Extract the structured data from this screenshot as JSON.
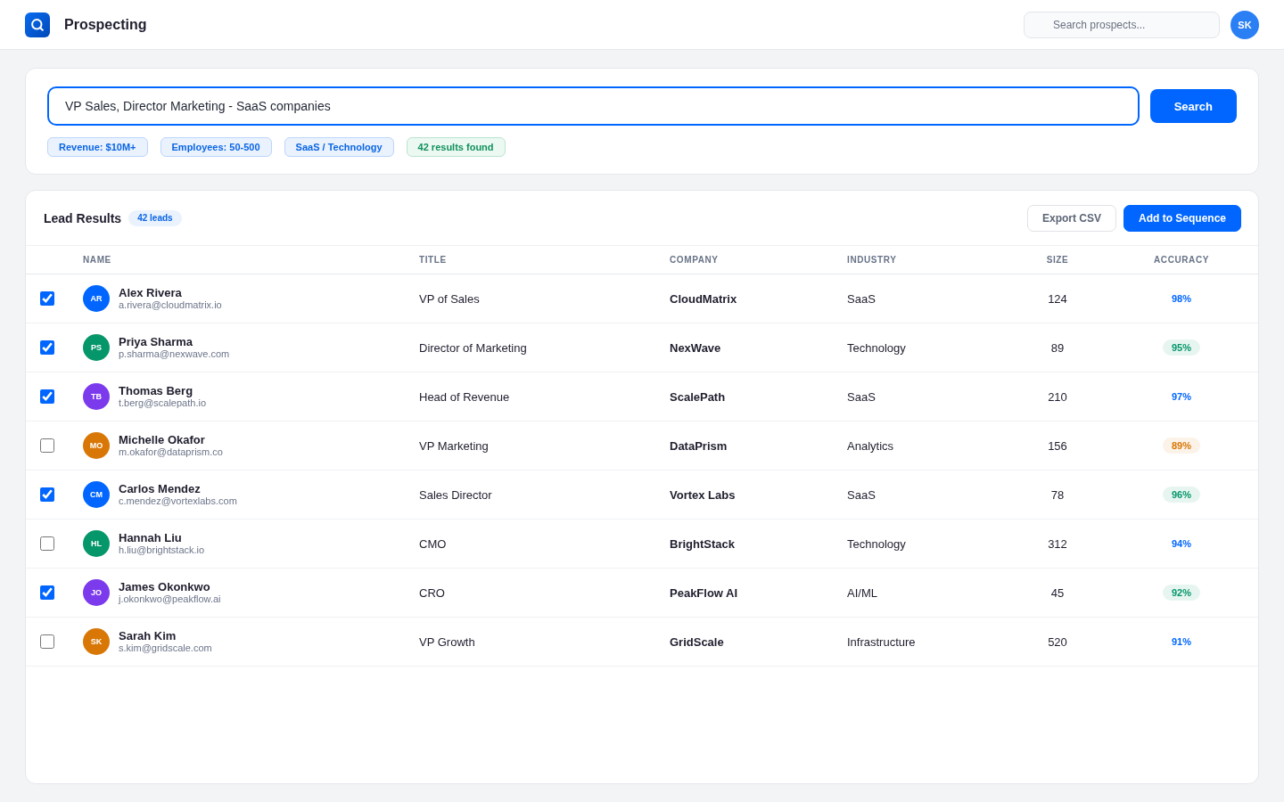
{
  "app": {
    "title": "Prospecting",
    "search": {
      "placeholder": "Search prospects..."
    },
    "user_initials": "SK"
  },
  "query": {
    "value": "VP Sales, Director Marketing - SaaS companies",
    "button": "Search",
    "chips": [
      {
        "label": "Revenue: $10M+",
        "kind": "filter"
      },
      {
        "label": "Employees: 50-500",
        "kind": "filter"
      },
      {
        "label": "SaaS / Technology",
        "kind": "filter"
      },
      {
        "label": "42 results found",
        "kind": "count"
      }
    ]
  },
  "results": {
    "title": "Lead Results",
    "count": "42 leads",
    "buttons": [
      {
        "label": "Export CSV",
        "kind": "secondary"
      },
      {
        "label": "Add to Sequence",
        "kind": "primary"
      }
    ],
    "columns": [
      "NAME",
      "TITLE",
      "COMPANY",
      "INDUSTRY",
      "SIZE",
      "ACCURACY"
    ],
    "rows": [
      {
        "checked": true,
        "initials": "AR",
        "color": "#0066ff",
        "name": "Alex Rivera",
        "email": "a.rivera@cloudmatrix.io",
        "title": "VP of Sales",
        "company": "CloudMatrix",
        "industry": "SaaS",
        "size": "124",
        "accuracy": {
          "value": "98%",
          "kind": "plain",
          "color": "#0066ff"
        }
      },
      {
        "checked": true,
        "initials": "PS",
        "color": "#059669",
        "name": "Priya Sharma",
        "email": "p.sharma@nexwave.com",
        "title": "Director of Marketing",
        "company": "NexWave",
        "industry": "Technology",
        "size": "89",
        "accuracy": {
          "value": "95%",
          "kind": "pill",
          "color": "#059669"
        }
      },
      {
        "checked": true,
        "initials": "TB",
        "color": "#7c3aed",
        "name": "Thomas Berg",
        "email": "t.berg@scalepath.io",
        "title": "Head of Revenue",
        "company": "ScalePath",
        "industry": "SaaS",
        "size": "210",
        "accuracy": {
          "value": "97%",
          "kind": "plain",
          "color": "#0066ff"
        }
      },
      {
        "checked": false,
        "initials": "MO",
        "color": "#d97706",
        "name": "Michelle Okafor",
        "email": "m.okafor@dataprism.co",
        "title": "VP Marketing",
        "company": "DataPrism",
        "industry": "Analytics",
        "size": "156",
        "accuracy": {
          "value": "89%",
          "kind": "pill",
          "color": "#d97706"
        }
      },
      {
        "checked": true,
        "initials": "CM",
        "color": "#0066ff",
        "name": "Carlos Mendez",
        "email": "c.mendez@vortexlabs.com",
        "title": "Sales Director",
        "company": "Vortex Labs",
        "industry": "SaaS",
        "size": "78",
        "accuracy": {
          "value": "96%",
          "kind": "pill",
          "color": "#059669"
        }
      },
      {
        "checked": false,
        "initials": "HL",
        "color": "#059669",
        "name": "Hannah Liu",
        "email": "h.liu@brightstack.io",
        "title": "CMO",
        "company": "BrightStack",
        "industry": "Technology",
        "size": "312",
        "accuracy": {
          "value": "94%",
          "kind": "plain",
          "color": "#0066ff"
        }
      },
      {
        "checked": true,
        "initials": "JO",
        "color": "#7c3aed",
        "name": "James Okonkwo",
        "email": "j.okonkwo@peakflow.ai",
        "title": "CRO",
        "company": "PeakFlow AI",
        "industry": "AI/ML",
        "size": "45",
        "accuracy": {
          "value": "92%",
          "kind": "pill",
          "color": "#059669"
        }
      },
      {
        "checked": false,
        "initials": "SK",
        "color": "#d97706",
        "name": "Sarah Kim",
        "email": "s.kim@gridscale.com",
        "title": "VP Growth",
        "company": "GridScale",
        "industry": "Infrastructure",
        "size": "520",
        "accuracy": {
          "value": "91%",
          "kind": "plain",
          "color": "#0066ff"
        }
      }
    ]
  }
}
